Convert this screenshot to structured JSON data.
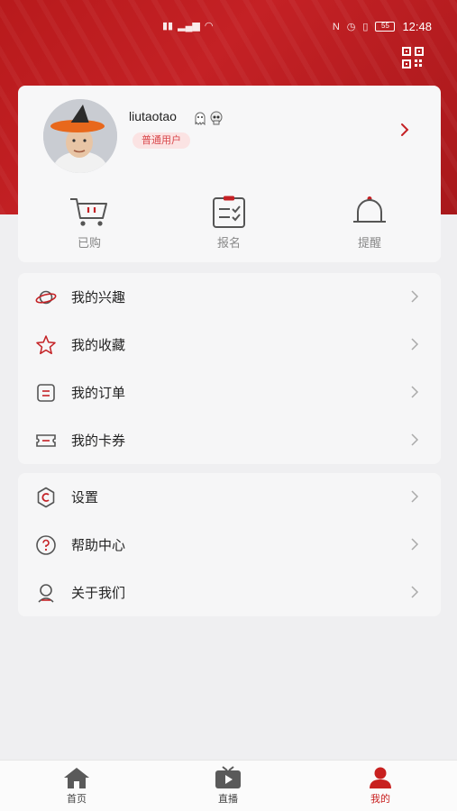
{
  "status_bar": {
    "time": "12:48",
    "battery": "55"
  },
  "profile": {
    "username": "liutaotao",
    "badge": "普通用户",
    "emojis": [
      "ghost",
      "skull"
    ]
  },
  "shortcuts": [
    {
      "label": "已购",
      "icon": "cart-icon"
    },
    {
      "label": "报名",
      "icon": "clipboard-icon"
    },
    {
      "label": "提醒",
      "icon": "bell-icon"
    }
  ],
  "menu_group_1": [
    {
      "label": "我的兴趣",
      "icon": "planet-icon"
    },
    {
      "label": "我的收藏",
      "icon": "star-icon"
    },
    {
      "label": "我的订单",
      "icon": "order-icon"
    },
    {
      "label": "我的卡券",
      "icon": "coupon-icon"
    }
  ],
  "menu_group_2": [
    {
      "label": "设置",
      "icon": "settings-icon"
    },
    {
      "label": "帮助中心",
      "icon": "help-icon"
    },
    {
      "label": "关于我们",
      "icon": "about-icon"
    }
  ],
  "bottom_nav": [
    {
      "label": "首页",
      "icon": "home-icon",
      "active": false
    },
    {
      "label": "直播",
      "icon": "tv-icon",
      "active": false
    },
    {
      "label": "我的",
      "icon": "user-icon",
      "active": true
    }
  ],
  "colors": {
    "brand": "#c42125",
    "badge_bg": "#fbe3e3",
    "badge_text": "#d9484c",
    "active_nav": "#c8201f"
  }
}
